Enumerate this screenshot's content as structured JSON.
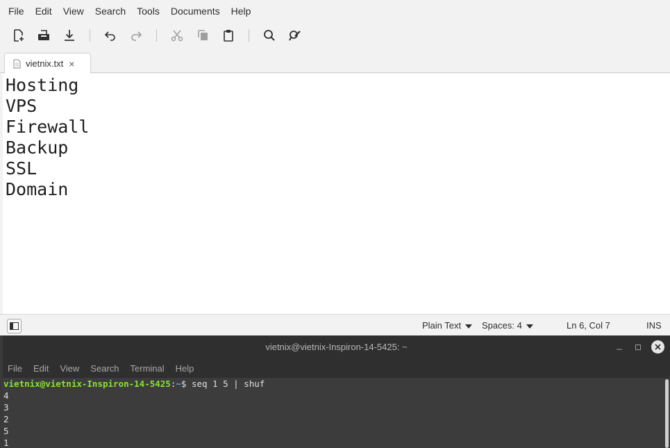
{
  "editor": {
    "menu": [
      "File",
      "Edit",
      "View",
      "Search",
      "Tools",
      "Documents",
      "Help"
    ],
    "toolbar": {
      "groups": [
        [
          "new-document-icon",
          "open-icon",
          "save-icon"
        ],
        [
          "undo-icon",
          "redo-icon"
        ],
        [
          "cut-icon",
          "copy-icon",
          "paste-icon"
        ],
        [
          "search-icon",
          "replace-icon"
        ]
      ]
    },
    "tab": {
      "label": "vietnix.txt",
      "close": "×"
    },
    "lines": [
      "Hosting",
      "VPS",
      "Firewall",
      "Backup",
      "SSL",
      "Domain"
    ],
    "status": {
      "language": "Plain Text",
      "spaces": "Spaces: 4",
      "position": "Ln 6, Col 7",
      "mode": "INS"
    }
  },
  "terminal": {
    "title": "vietnix@vietnix-Inspiron-14-5425: ~",
    "menu": [
      "File",
      "Edit",
      "View",
      "Search",
      "Terminal",
      "Help"
    ],
    "prompt": {
      "user_host": "vietnix@vietnix-Inspiron-14-5425",
      "sep": ":",
      "path": "~",
      "symbol": "$",
      "command": " seq 1 5 | shuf"
    },
    "output": [
      "4",
      "3",
      "2",
      "5",
      "1"
    ],
    "colors": {
      "prompt_user": "#8ae234",
      "prompt_path": "#729fcf"
    }
  }
}
